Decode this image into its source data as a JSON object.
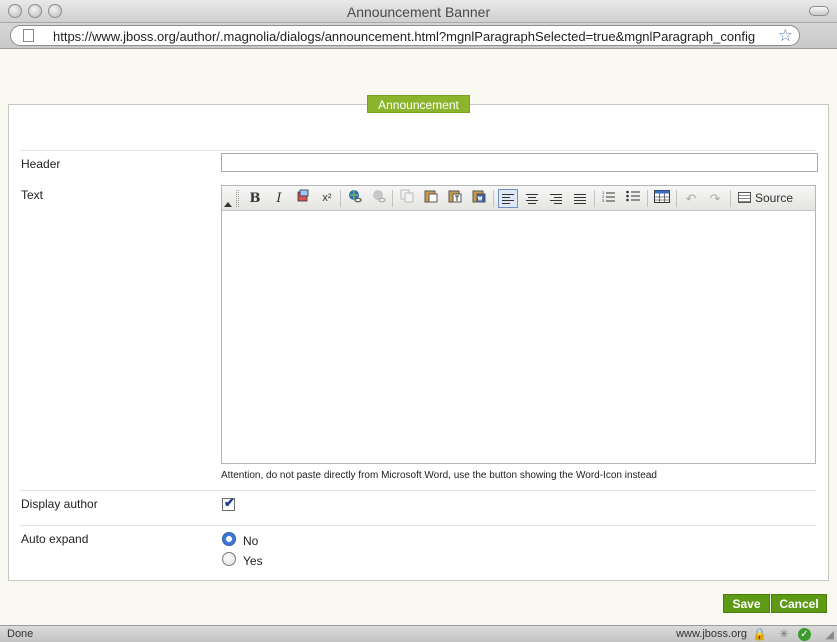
{
  "window": {
    "title": "Announcement Banner",
    "url": "https://www.jboss.org/author/.magnolia/dialogs/announcement.html?mgnlParagraphSelected=true&mgnlParagraph_config"
  },
  "dialog": {
    "tab_label": "Announcement",
    "fields": {
      "header_label": "Header",
      "header_value": "",
      "text_label": "Text",
      "attention": "Attention, do not paste directly from Microsoft Word, use the button showing the Word-Icon instead",
      "display_author_label": "Display author",
      "display_author_checked": true,
      "auto_expand_label": "Auto expand",
      "auto_expand_options": [
        "No",
        "Yes"
      ],
      "auto_expand_selected": "No"
    },
    "toolbar": {
      "bold": "B",
      "italic": "I",
      "superscript": "x²",
      "source_label": "Source"
    },
    "buttons": {
      "save": "Save",
      "cancel": "Cancel"
    }
  },
  "statusbar": {
    "status": "Done",
    "domain": "www.jboss.org"
  },
  "colors": {
    "accent_green": "#5e9a16",
    "tab_green": "#8cb42c"
  }
}
